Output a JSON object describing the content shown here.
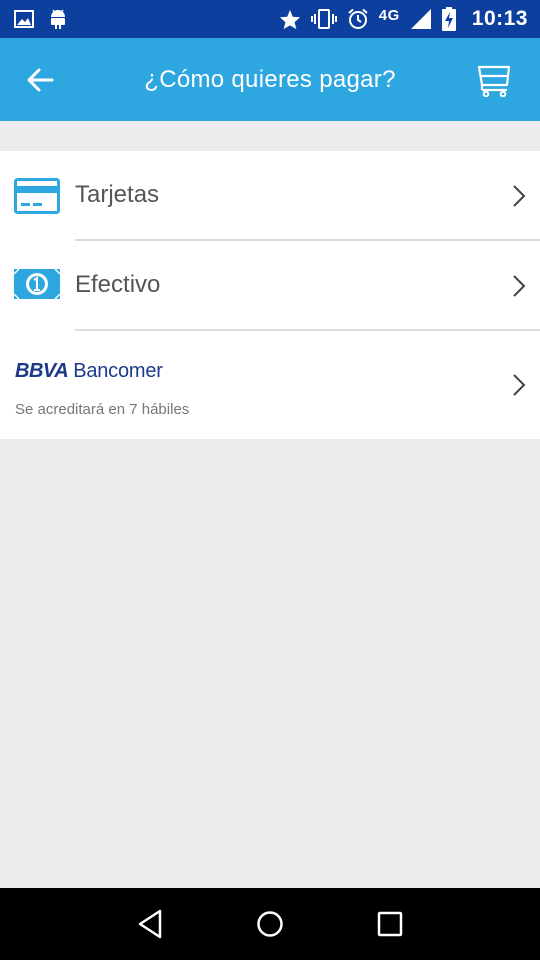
{
  "status_bar": {
    "network": "4G",
    "time": "10:13",
    "icons": [
      "image-icon",
      "android-icon",
      "star-icon",
      "vibrate-icon",
      "alarm-icon",
      "signal-icon",
      "battery-icon"
    ]
  },
  "header": {
    "title": "¿Cómo quieres pagar?",
    "back_icon": "arrow-left-icon",
    "cart_icon": "cart-icon"
  },
  "payment_options": [
    {
      "label": "Tarjetas",
      "icon": "credit-card-icon"
    },
    {
      "label": "Efectivo",
      "icon": "cash-icon"
    },
    {
      "logo_strong": "BBVA",
      "logo_name": "Bancomer",
      "subtitle": "Se acreditará en 7 hábiles"
    }
  ],
  "nav_bar": {
    "icons": [
      "back-triangle-icon",
      "home-circle-icon",
      "recents-square-icon"
    ]
  },
  "colors": {
    "status_bar": "#0d3f9e",
    "app_bar": "#2ea6e0",
    "background": "#ececec",
    "icon_blue": "#2ea6e0",
    "bbva_blue": "#1d3a8a"
  }
}
